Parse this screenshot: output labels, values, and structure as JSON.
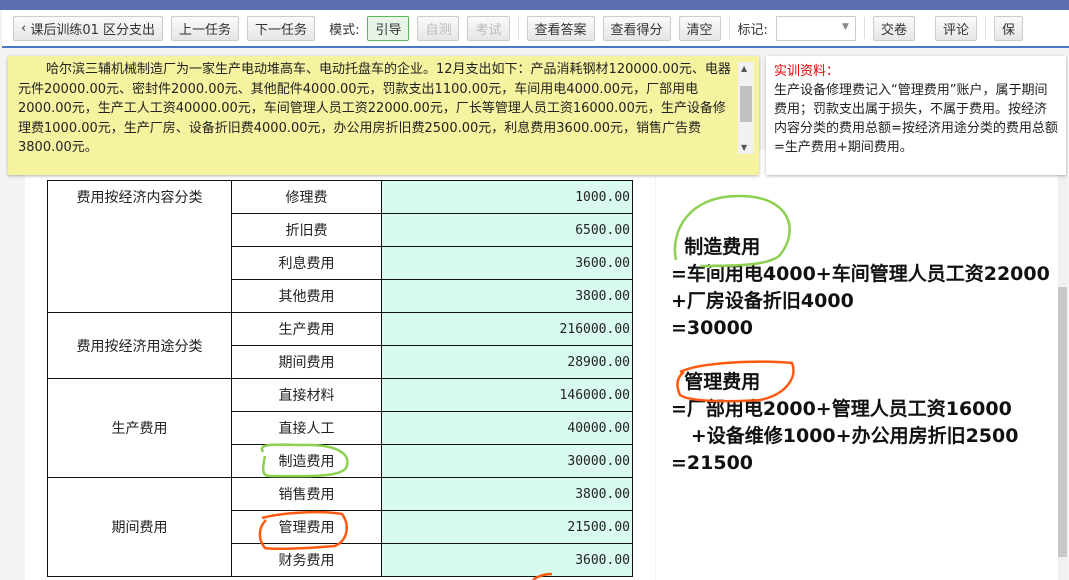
{
  "toolbar": {
    "back_label": "课后训练01 区分支出",
    "prev_task": "上一任务",
    "next_task": "下一任务",
    "mode_label": "模式:",
    "mode_guide": "引导",
    "mode_self_test": "自测",
    "mode_exam": "考试",
    "view_answer": "查看答案",
    "view_score": "查看得分",
    "clear": "清空",
    "mark_label": "标记:",
    "mark_value": "",
    "submit": "交卷",
    "comment": "评论",
    "more": "保"
  },
  "problem": {
    "text": "哈尔滨三辅机械制造厂为一家生产电动堆高车、电动托盘车的企业。12月支出如下：产品消耗钢材120000.00元、电器元件20000.00元、密封件2000.00元、其他配件4000.00元，罚款支出1100.00元，车间用电4000.00元，厂部用电2000.00元，生产工人工资40000.00元，车间管理人员工资22000.00元，厂长等管理人员工资16000.00元，生产设备修理费1000.00元，生产厂房、设备折旧费4000.00元，办公用房折旧费2500.00元，利息费用3600.00元，销售广告费3800.00元。"
  },
  "note": {
    "title": "实训资料：",
    "text": "生产设备修理费记入“管理费用”账户，属于期间费用；罚款支出属于损失，不属于费用。按经济内容分类的费用总额=按经济用途分类的费用总额=生产费用+期间费用。"
  },
  "table": {
    "groups": [
      {
        "label": "费用按经济内容分类",
        "rows": [
          {
            "item": "修理费",
            "value": "1000.00"
          },
          {
            "item": "折旧费",
            "value": "6500.00"
          },
          {
            "item": "利息费用",
            "value": "3600.00"
          },
          {
            "item": "其他费用",
            "value": "3800.00"
          }
        ]
      },
      {
        "label": "费用按经济用途分类",
        "rows": [
          {
            "item": "生产费用",
            "value": "216000.00"
          },
          {
            "item": "期间费用",
            "value": "28900.00"
          }
        ]
      },
      {
        "label": "生产费用",
        "rows": [
          {
            "item": "直接材料",
            "value": "146000.00"
          },
          {
            "item": "直接人工",
            "value": "40000.00"
          },
          {
            "item": "制造费用",
            "value": "30000.00"
          }
        ]
      },
      {
        "label": "期间费用",
        "rows": [
          {
            "item": "销售费用",
            "value": "3800.00"
          },
          {
            "item": "管理费用",
            "value": "21500.00"
          },
          {
            "item": "财务费用",
            "value": "3600.00"
          }
        ]
      }
    ]
  },
  "annotation": {
    "lines": [
      "  制造费用",
      "=车间用电4000+车间管理人员工资22000",
      "+厂房设备折旧4000",
      "=30000",
      "",
      "  管理费用",
      "=厂部用电2000+管理人员工资16000",
      "   +设备维修1000+办公用房折旧2500",
      "=21500"
    ]
  },
  "colors": {
    "green_circle": "#8cd050",
    "orange_circle": "#ff5a10"
  }
}
